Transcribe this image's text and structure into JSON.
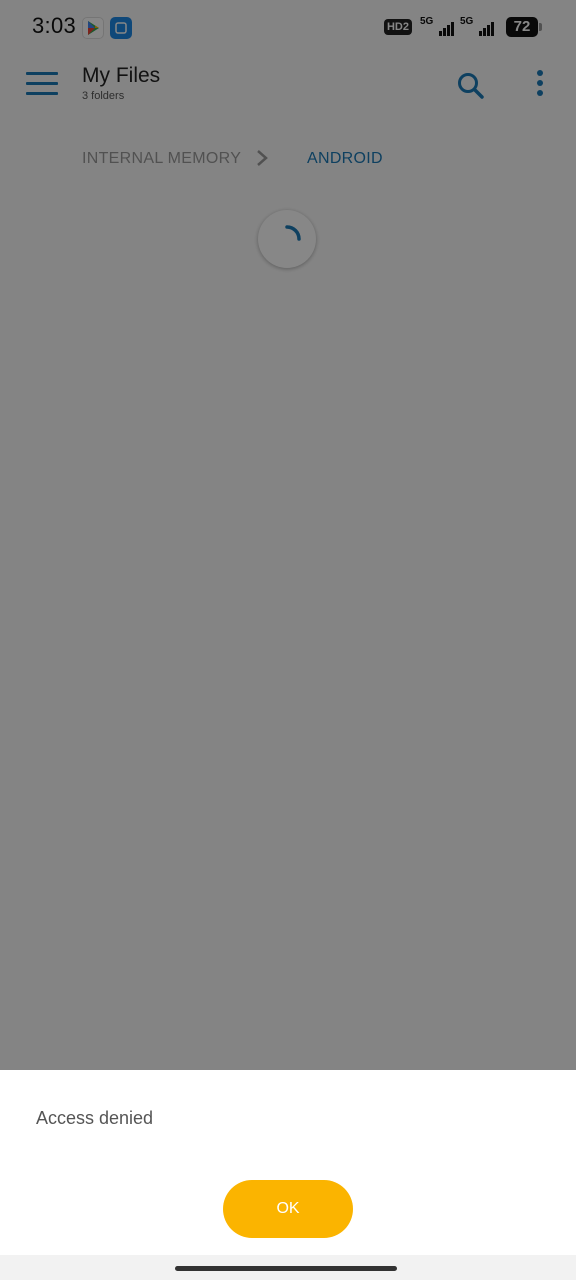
{
  "status_bar": {
    "time": "3:03",
    "hd_badge": "HD2",
    "network_1": "5G",
    "network_2": "5G",
    "battery": "72",
    "notification_icons": [
      "play-store-icon",
      "app-notification-icon"
    ]
  },
  "app_bar": {
    "title": "My Files",
    "subtitle": "3 folders",
    "icons": [
      "menu-icon",
      "search-icon",
      "more-vert-icon"
    ],
    "accent_color": "#1b79b5"
  },
  "breadcrumb": {
    "items": [
      "INTERNAL MEMORY",
      "ANDROID"
    ],
    "active_index": 1
  },
  "dialog": {
    "message": "Access denied",
    "ok_label": "OK",
    "ok_color": "#fbb400"
  }
}
